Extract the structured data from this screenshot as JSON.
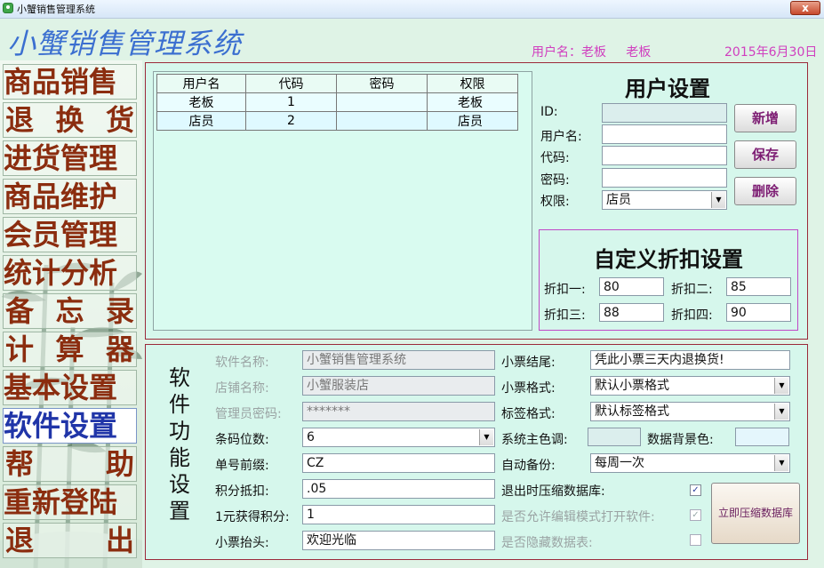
{
  "window": {
    "title": "小蟹销售管理系统",
    "close_label": "x"
  },
  "header": {
    "title": "小蟹销售管理系统",
    "user_label": "用户名：老板",
    "user_role": "老板",
    "date": "2015年6月30日"
  },
  "sidebar": {
    "items": [
      {
        "label": "商品销售"
      },
      {
        "label": "退换货"
      },
      {
        "label": "进货管理"
      },
      {
        "label": "商品维护"
      },
      {
        "label": "会员管理"
      },
      {
        "label": "统计分析"
      },
      {
        "label": "备忘录"
      },
      {
        "label": "计算器"
      },
      {
        "label": "基本设置"
      },
      {
        "label": "软件设置",
        "active": true
      },
      {
        "label": "帮助"
      },
      {
        "label": "重新登陆"
      },
      {
        "label": "退出"
      }
    ]
  },
  "users_table": {
    "columns": [
      "用户名",
      "代码",
      "密码",
      "权限"
    ],
    "rows": [
      [
        "老板",
        "1",
        "",
        "老板"
      ],
      [
        "店员",
        "2",
        "",
        "店员"
      ]
    ]
  },
  "user_settings": {
    "title": "用户设置",
    "id_label": "ID:",
    "id_value": "",
    "username_label": "用户名:",
    "username_value": "",
    "code_label": "代码:",
    "code_value": "",
    "password_label": "密码:",
    "password_value": "",
    "role_label": "权限:",
    "role_value": "店员",
    "btn_new": "新增",
    "btn_save": "保存",
    "btn_delete": "删除"
  },
  "discount": {
    "title": "自定义折扣设置",
    "d1_label": "折扣一:",
    "d1_value": "80",
    "d2_label": "折扣二:",
    "d2_value": "85",
    "d3_label": "折扣三:",
    "d3_value": "88",
    "d4_label": "折扣四:",
    "d4_value": "90"
  },
  "software": {
    "section_title": [
      "软",
      "件",
      "功",
      "能",
      "设",
      "置"
    ],
    "software_name_label": "软件名称:",
    "software_name_value": "小蟹销售管理系统",
    "shop_name_label": "店铺名称:",
    "shop_name_value": "小蟹服装店",
    "admin_password_label": "管理员密码:",
    "admin_password_value": "*******",
    "barcode_digits_label": "条码位数:",
    "barcode_digits_value": "6",
    "order_prefix_label": "单号前缀:",
    "order_prefix_value": "CZ",
    "points_deduct_label": "积分抵扣:",
    "points_deduct_value": ".05",
    "points_per_yuan_label": "1元获得积分:",
    "points_per_yuan_value": "1",
    "receipt_header_label": "小票抬头:",
    "receipt_header_value": "欢迎光临",
    "receipt_footer_label": "小票结尾:",
    "receipt_footer_value": "凭此小票三天内退换货!",
    "receipt_format_label": "小票格式:",
    "receipt_format_value": "默认小票格式",
    "label_format_label": "标签格式:",
    "label_format_value": "默认标签格式",
    "main_color_label": "系统主色调:",
    "data_bg_label": "数据背景色:",
    "auto_backup_label": "自动备份:",
    "auto_backup_value": "每周一次",
    "compress_on_exit_label": "退出时压缩数据库:",
    "allow_edit_mode_label": "是否允许编辑模式打开软件:",
    "hide_data_table_label": "是否隐藏数据表:",
    "compress_now_button": "立即压缩数据库",
    "colors": {
      "main": "#dbeeed",
      "data_bg": "#e4f6fc"
    }
  }
}
